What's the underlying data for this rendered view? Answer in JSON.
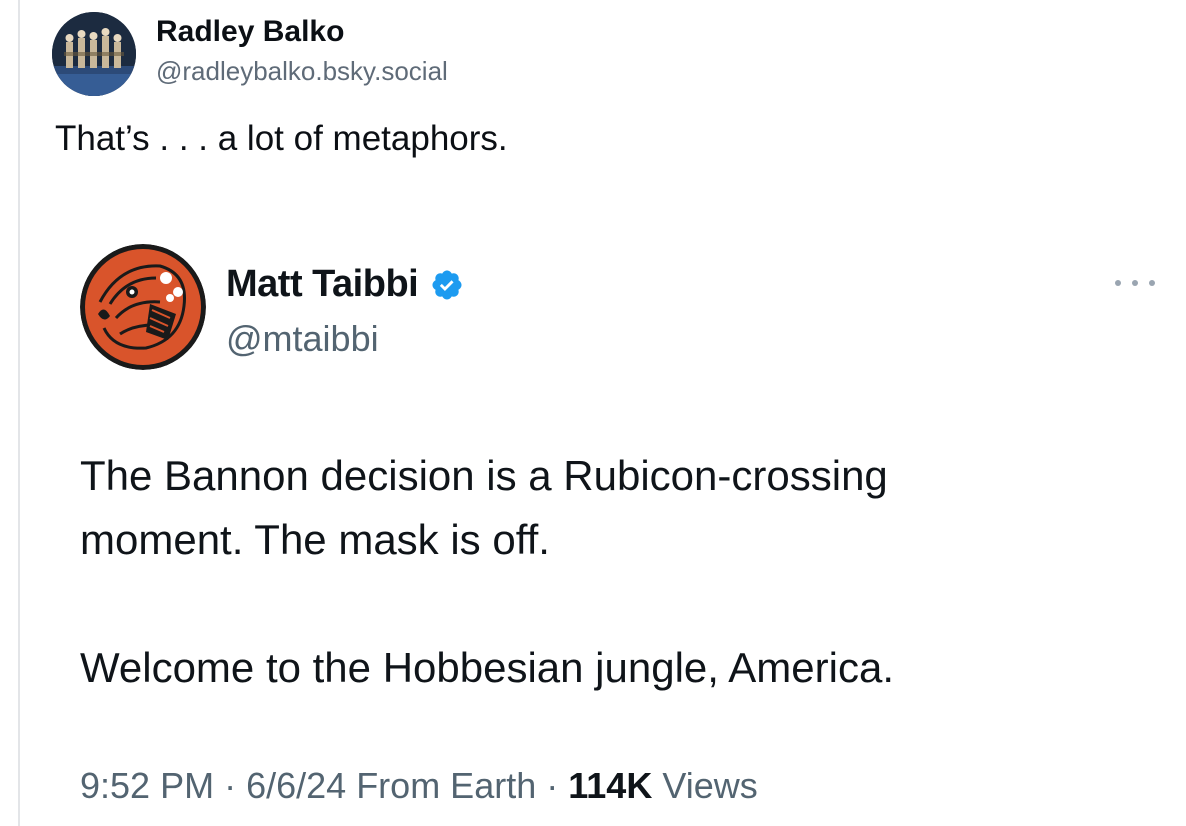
{
  "post": {
    "author_name": "Radley Balko",
    "author_handle": "@radleybalko.bsky.social",
    "text": "That’s . . . a lot of metaphors."
  },
  "quoted_post": {
    "author_name": "Matt Taibbi",
    "author_handle": "@mtaibbi",
    "verified": true,
    "lines": [
      "The Bannon decision is a Rubicon-crossing",
      "moment. The mask is off.",
      "Welcome to the Hobbesian jungle, America."
    ],
    "time": "9:52 PM",
    "date": "6/6/24",
    "source": "From Earth",
    "views_count": "114K",
    "views_label": "Views",
    "separator": " · "
  },
  "colors": {
    "verified_badge": "#1d9bf0",
    "avatar_orange": "#d9542b",
    "avatar_dark": "#1a1a1a"
  },
  "icons": {
    "verified": "verified-badge-icon",
    "more": "more-options-icon"
  }
}
